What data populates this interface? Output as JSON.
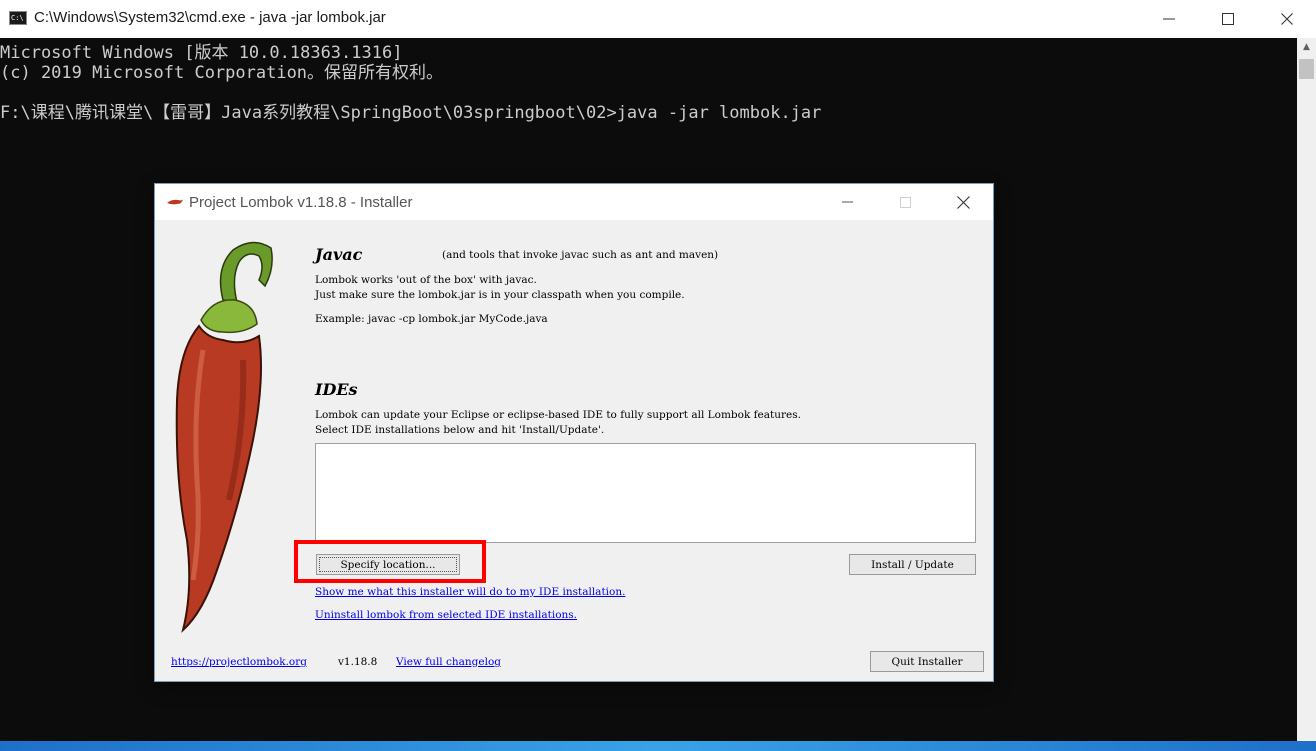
{
  "cmd": {
    "title": "C:\\Windows\\System32\\cmd.exe - java  -jar lombok.jar",
    "icon_text": "C:\\",
    "lines": [
      "Microsoft Windows [版本 10.0.18363.1316]",
      "(c) 2019 Microsoft Corporation。保留所有权利。",
      "",
      "F:\\课程\\腾讯课堂\\【雷哥】Java系列教程\\SpringBoot\\03springboot\\02>java -jar lombok.jar"
    ]
  },
  "dialog": {
    "title": "Project Lombok v1.18.8 - Installer",
    "javac": {
      "heading": "Javac",
      "subheading": "(and tools that invoke javac such as ant and maven)",
      "line1": "Lombok works 'out of the box' with javac.",
      "line2": "Just make sure the lombok.jar is in your classpath when you compile.",
      "example": "Example: javac -cp lombok.jar MyCode.java"
    },
    "ides": {
      "heading": "IDEs",
      "line1": "Lombok can update your Eclipse or eclipse-based IDE to fully support all Lombok features.",
      "line2": "Select IDE installations below and hit 'Install/Update'."
    },
    "buttons": {
      "specify": "Specify location...",
      "install": "Install / Update",
      "quit": "Quit Installer"
    },
    "links": {
      "show": "Show me what this installer will do to my IDE installation.",
      "uninstall": "Uninstall lombok from selected IDE installations.",
      "site": "https://projectlombok.org",
      "changelog": "View full changelog"
    },
    "version": "v1.18.8"
  },
  "colors": {
    "highlight": "#ff0000",
    "link": "#0000ee",
    "pepper": "#b83a22",
    "stem": "#6a9a2a"
  }
}
